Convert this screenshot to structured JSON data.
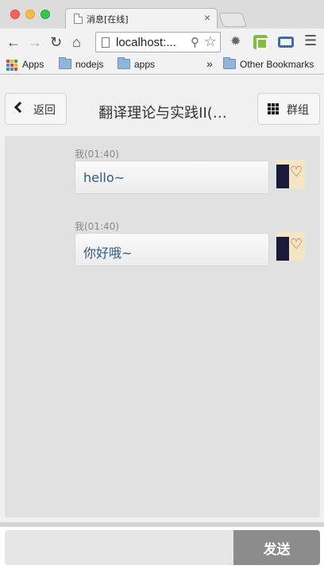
{
  "browser": {
    "tab_title": "消息[在线]",
    "tab_close": "×",
    "url": "localhost:...",
    "bookmarks": [
      {
        "label": "Apps",
        "icon": "apps-grid-icon"
      },
      {
        "label": "nodejs",
        "icon": "folder-icon"
      },
      {
        "label": "apps",
        "icon": "folder-icon"
      }
    ],
    "bookmarks_overflow": "»",
    "other_bookmarks": "Other Bookmarks",
    "icons": {
      "back": "back-arrow-icon",
      "forward": "forward-arrow-icon",
      "reload": "reload-icon",
      "home": "home-icon",
      "zoom": "zoom-icon",
      "star": "star-icon",
      "menu": "hamburger-menu-icon"
    },
    "colors": {
      "close": "#fc605c",
      "minimize": "#fdbc40",
      "maximize": "#34c84a"
    }
  },
  "header": {
    "back_label": "返回",
    "title": "翻译理论与实践II(…",
    "group_label": "群组"
  },
  "messages": [
    {
      "meta": "我(01:40)",
      "text": "hello~"
    },
    {
      "meta": "我(01:40)",
      "text": "你好哦~"
    }
  ],
  "composer": {
    "input_value": "",
    "send_label": "发送"
  },
  "theme": {
    "message_text_color": "#2f5b82",
    "send_button_color": "#8c8c8c"
  }
}
